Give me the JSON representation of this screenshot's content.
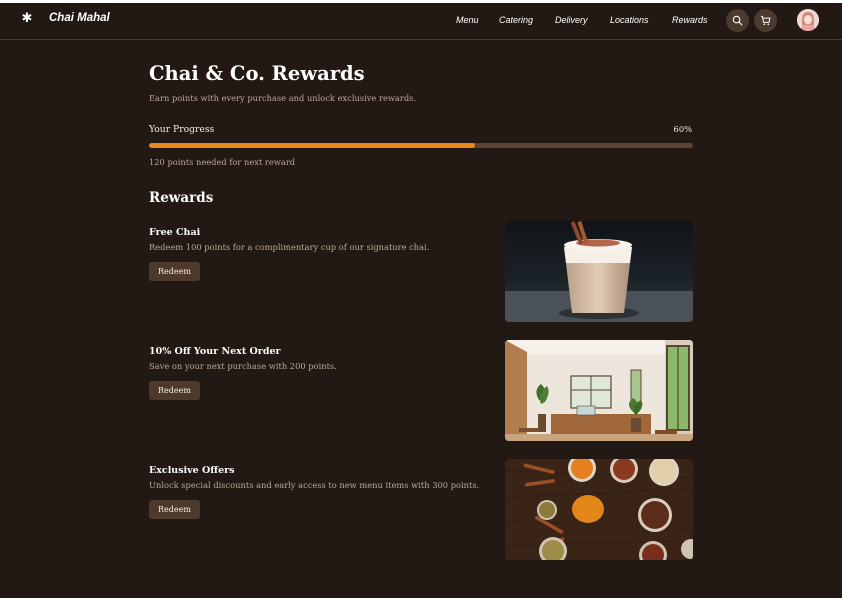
{
  "app": {
    "brand": "Chai Mahal",
    "logo_icon": "asterisk-icon"
  },
  "nav": {
    "items": [
      "Menu",
      "Catering",
      "Delivery",
      "Locations",
      "Rewards"
    ],
    "search_icon": "search-icon",
    "cart_icon": "cart-icon",
    "avatar_icon": "user-avatar"
  },
  "page": {
    "title": "Chai & Co. Rewards",
    "subtitle": "Earn points with every purchase and unlock exclusive rewards."
  },
  "progress": {
    "label": "Your Progress",
    "percent_text": "60%",
    "fraction": 0.6,
    "note": "120 points needed for next reward",
    "color": "#e98a1f"
  },
  "rewards": {
    "heading": "Rewards",
    "items": [
      {
        "title": "Free Chai",
        "description": "Redeem 100 points for a complimentary cup of our signature chai.",
        "button": "Redeem",
        "image": "chai-latte-photo"
      },
      {
        "title": "10% Off Your Next Order",
        "description": "Save on your next purchase with 200 points.",
        "button": "Redeem",
        "image": "cafe-interior-photo"
      },
      {
        "title": "Exclusive Offers",
        "description": "Unlock special discounts and early access to new menu items with 300 points.",
        "button": "Redeem",
        "image": "spices-photo"
      }
    ]
  },
  "colors": {
    "background": "#221914",
    "button": "#4d3a2c",
    "accent": "#e98a1f"
  }
}
